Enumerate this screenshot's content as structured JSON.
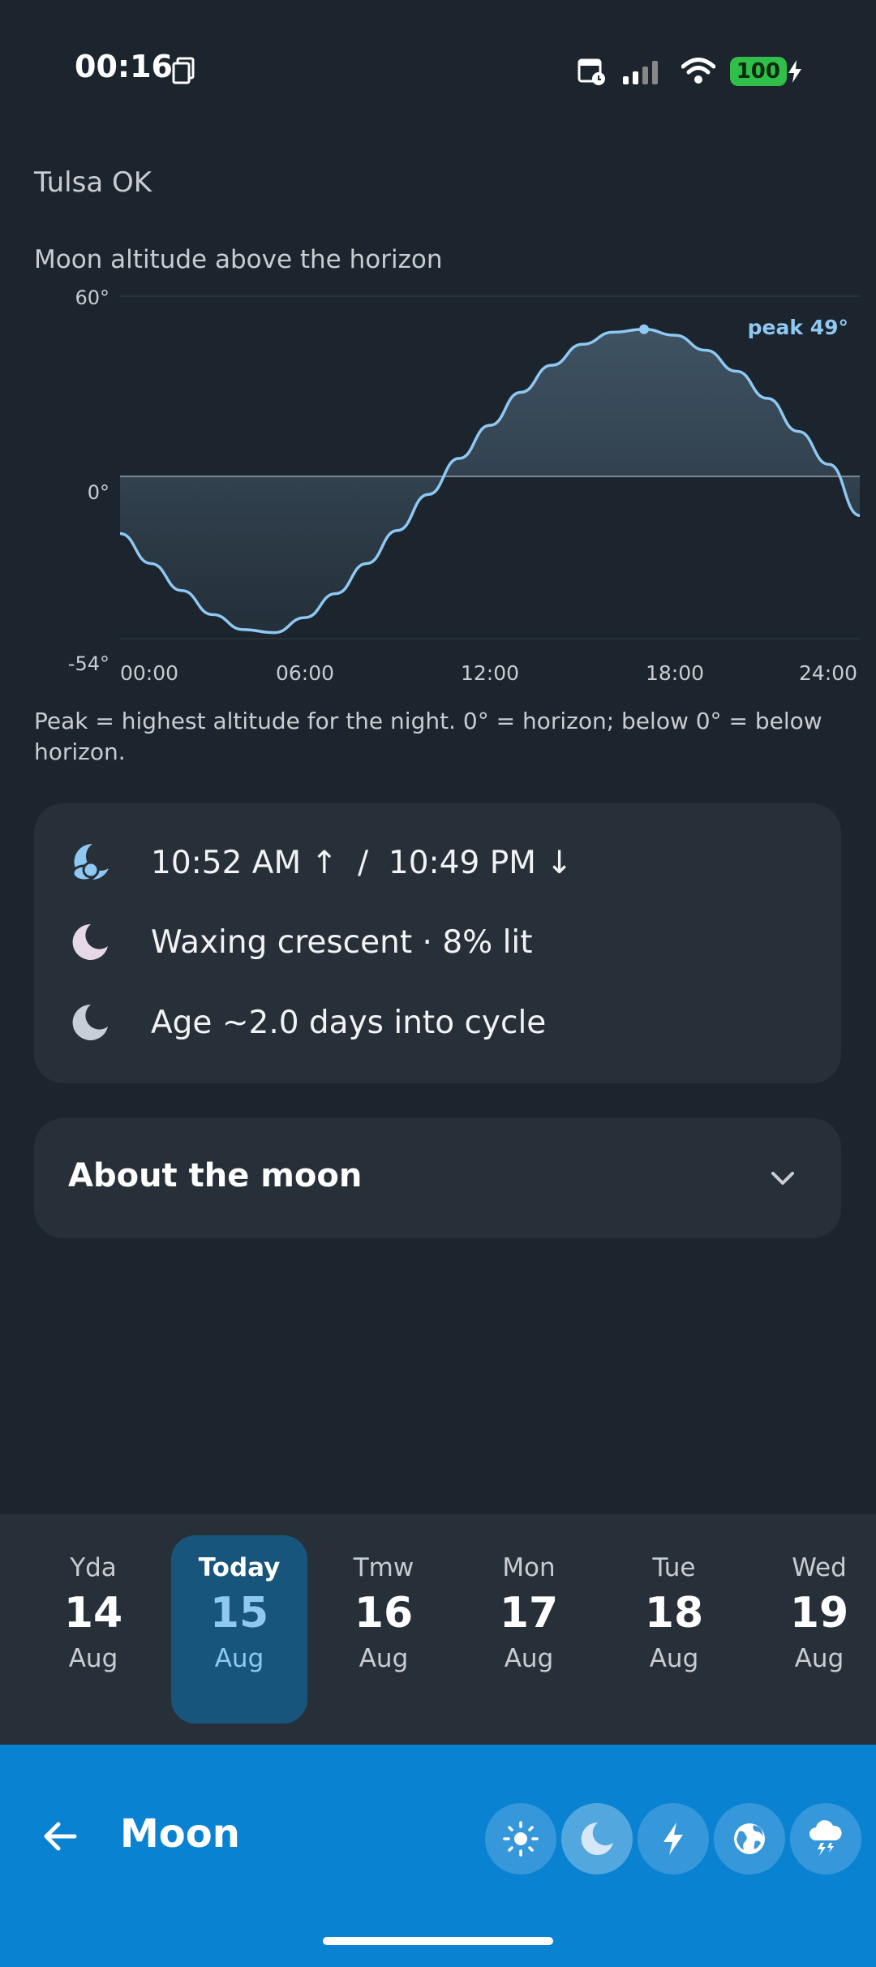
{
  "status_bar": {
    "time": "00:16",
    "battery": "100"
  },
  "location": "Tulsa OK",
  "chart_data": {
    "type": "area",
    "title": "Moon altitude above the horizon",
    "ylim": [
      -54,
      60
    ],
    "yticks": [
      "60°",
      "0°",
      "-54°"
    ],
    "xticks": [
      "00:00",
      "06:00",
      "12:00",
      "18:00",
      "24:00"
    ],
    "x_hours": [
      0,
      1,
      2,
      3,
      4,
      5,
      6,
      7,
      8,
      9,
      10,
      11,
      12,
      13,
      14,
      15,
      16,
      17,
      18,
      19,
      20,
      21,
      22,
      23,
      24
    ],
    "altitude": [
      -19,
      -29,
      -38,
      -46,
      -51,
      -52,
      -47,
      -39,
      -29,
      -18,
      -6,
      6,
      17,
      28,
      37,
      44,
      48,
      49,
      47,
      42,
      35,
      26,
      15,
      4,
      -13
    ],
    "peak_label": "peak 49°",
    "peak_hour": 17
  },
  "chart_note": "Peak = highest altitude for the night. 0° = horizon; below 0° = below horizon.",
  "info": {
    "rise_set": "10:52 AM ↑  /  10:49 PM ↓",
    "phase": "Waxing crescent · 8% lit",
    "age": "Age ~2.0 days into cycle"
  },
  "about": {
    "title": "About the moon"
  },
  "days": [
    {
      "name": "Yda",
      "date": "14",
      "month": "Aug"
    },
    {
      "name": "Today",
      "date": "15",
      "month": "Aug"
    },
    {
      "name": "Tmw",
      "date": "16",
      "month": "Aug"
    },
    {
      "name": "Mon",
      "date": "17",
      "month": "Aug"
    },
    {
      "name": "Tue",
      "date": "18",
      "month": "Aug"
    },
    {
      "name": "Wed",
      "date": "19",
      "month": "Aug"
    }
  ],
  "bottom_bar": {
    "title": "Moon",
    "nav_icons": [
      "sun-icon",
      "moon-icon",
      "lightning-icon",
      "globe-icon",
      "storm-icon"
    ]
  },
  "colors": {
    "accent": "#8fc8f2",
    "bar": "#0a82d2",
    "card": "#273038",
    "background": "#1c252d"
  }
}
